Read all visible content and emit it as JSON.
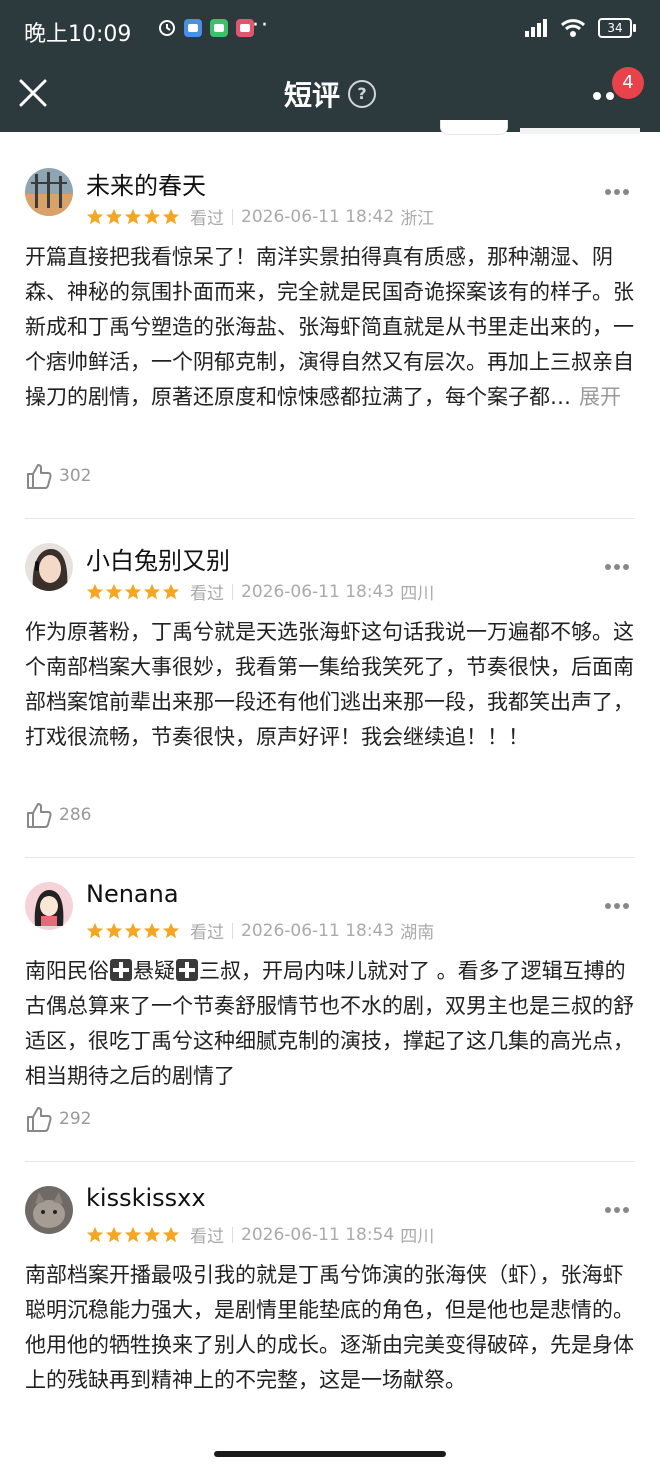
{
  "status_bar": {
    "time": "晚上10:09",
    "dots": "··",
    "battery": "34",
    "app_icon_colors": [
      "#4a90e2",
      "#3cc06a",
      "#e0566f"
    ]
  },
  "header": {
    "title": "短评",
    "help_icon": "question-circle-icon",
    "badge_count": "4",
    "background": "#2c3a3d"
  },
  "colors": {
    "star": "#f5a623",
    "badge": "#e8434a",
    "divider": "#e6e6e6"
  },
  "reviews": [
    {
      "username": "未来的春天",
      "rating": 5,
      "status": "看过",
      "datetime": "2026-06-11 18:42",
      "location": "浙江",
      "text": "开篇直接把我看惊呆了！南洋实景拍得真有质感，那种潮湿、阴森、神秘的氛围扑面而来，完全就是民国奇诡探案该有的样子。张新成和丁禹兮塑造的张海盐、张海虾简直就是从书里走出来的，一个痞帅鲜活，一个阴郁克制，演得自然又有层次。再加上三叔亲自操刀的剧情，原著还原度和惊悚感都拉满了，每个案子都…",
      "expand": "展开",
      "likes": "302"
    },
    {
      "username": "小白兔别又别",
      "rating": 5,
      "status": "看过",
      "datetime": "2026-06-11 18:43",
      "location": "四川",
      "text": "作为原著粉，丁禹兮就是天选张海虾这句话我说一万遍都不够。这个南部档案大事很妙，我看第一集给我笑死了，节奏很快，后面南部档案馆前辈出来那一段还有他们逃出来那一段，我都笑出声了，打戏很流畅，节奏很快，原声好评！我会继续追！！！",
      "likes": "286"
    },
    {
      "username": "Nenana",
      "rating": 5,
      "status": "看过",
      "datetime": "2026-06-11 18:43",
      "location": "湖南",
      "text_parts": [
        "南阳民俗",
        "悬疑",
        "三叔，开局内味儿就对了 。看多了逻辑互搏的古偶总算来了一个节奏舒服情节也不水的剧，双男主也是三叔的舒适区，很吃丁禹兮这种细腻克制的演技，撑起了这几集的高光点，相当期待之后的剧情了"
      ],
      "likes": "292"
    },
    {
      "username": "kisskissxx",
      "rating": 5,
      "status": "看过",
      "datetime": "2026-06-11 18:54",
      "location": "四川",
      "text": "南部档案开播最吸引我的就是丁禹兮饰演的张海侠（虾），张海虾聪明沉稳能力强大，是剧情里能垫底的角色，但是他也是悲情的。他用他的牺牲换来了别人的成长。逐渐由完美变得破碎，先是身体上的残缺再到精神上的不完整，这是一场献祭。"
    }
  ]
}
